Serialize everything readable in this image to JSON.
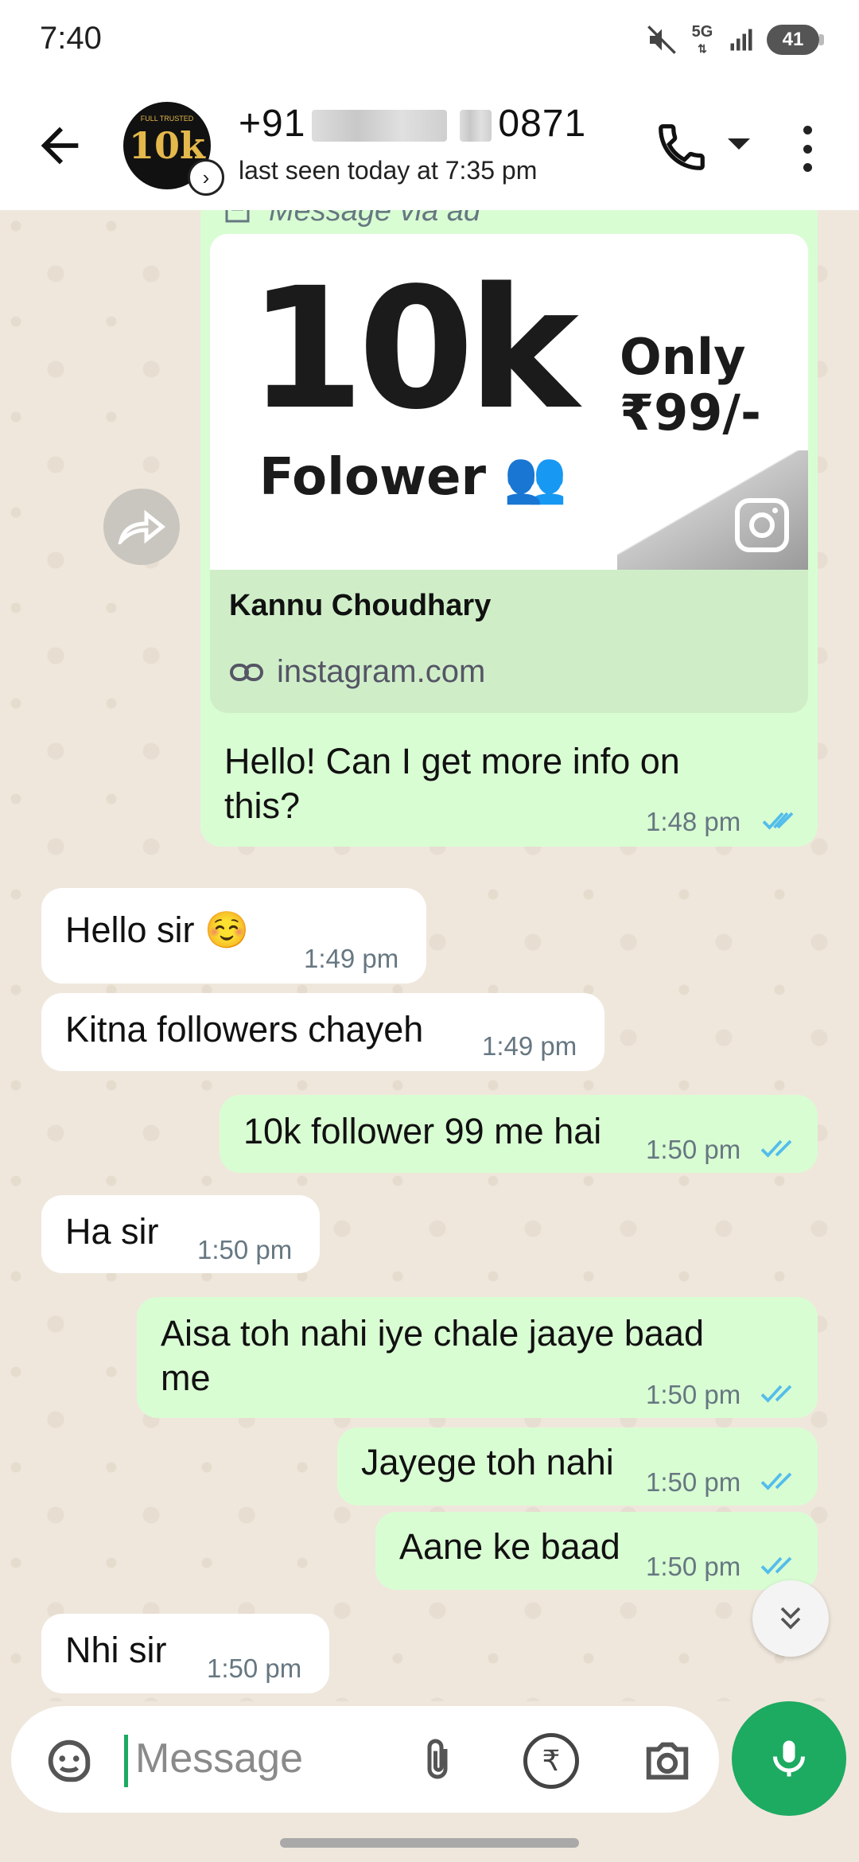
{
  "status_bar": {
    "time": "7:40",
    "network": "5G",
    "battery": "41"
  },
  "header": {
    "phone_prefix": "+91",
    "phone_suffix": "0871",
    "last_seen": "last seen today at 7:35 pm",
    "avatar_text": "10k",
    "avatar_subtext": "FULL TRUSTED"
  },
  "ad": {
    "via_label": "Message via ad",
    "image_big": "10k",
    "image_folower": "Folower 👥",
    "image_only": "Only",
    "image_price": "₹99/-",
    "title": "Kannu Choudhary",
    "link": "instagram.com"
  },
  "messages": [
    {
      "dir": "out",
      "text": "Hello! Can I get more info on this?",
      "time": "1:48 pm",
      "read": true
    },
    {
      "dir": "in",
      "text": "Hello sir ☺️",
      "time": "1:49 pm"
    },
    {
      "dir": "in",
      "text": "Kitna followers chayeh",
      "time": "1:49 pm"
    },
    {
      "dir": "out",
      "text": "10k follower 99 me hai",
      "time": "1:50 pm",
      "read": true
    },
    {
      "dir": "in",
      "text": "Ha sir",
      "time": "1:50 pm"
    },
    {
      "dir": "out",
      "text": "Aisa toh nahi iye chale jaaye baad me",
      "time": "1:50 pm",
      "read": true
    },
    {
      "dir": "out",
      "text": "Jayege toh nahi",
      "time": "1:50 pm",
      "read": true
    },
    {
      "dir": "out",
      "text": "Aane ke baad",
      "time": "1:50 pm",
      "read": true
    },
    {
      "dir": "in",
      "text": "Nhi sir",
      "time": "1:50 pm"
    }
  ],
  "composer": {
    "placeholder": "Message",
    "rupee_symbol": "₹"
  },
  "colors": {
    "outgoing": "#d9fdd3",
    "incoming": "#ffffff",
    "accent": "#1daa61",
    "read_ticks": "#53bdeb"
  }
}
